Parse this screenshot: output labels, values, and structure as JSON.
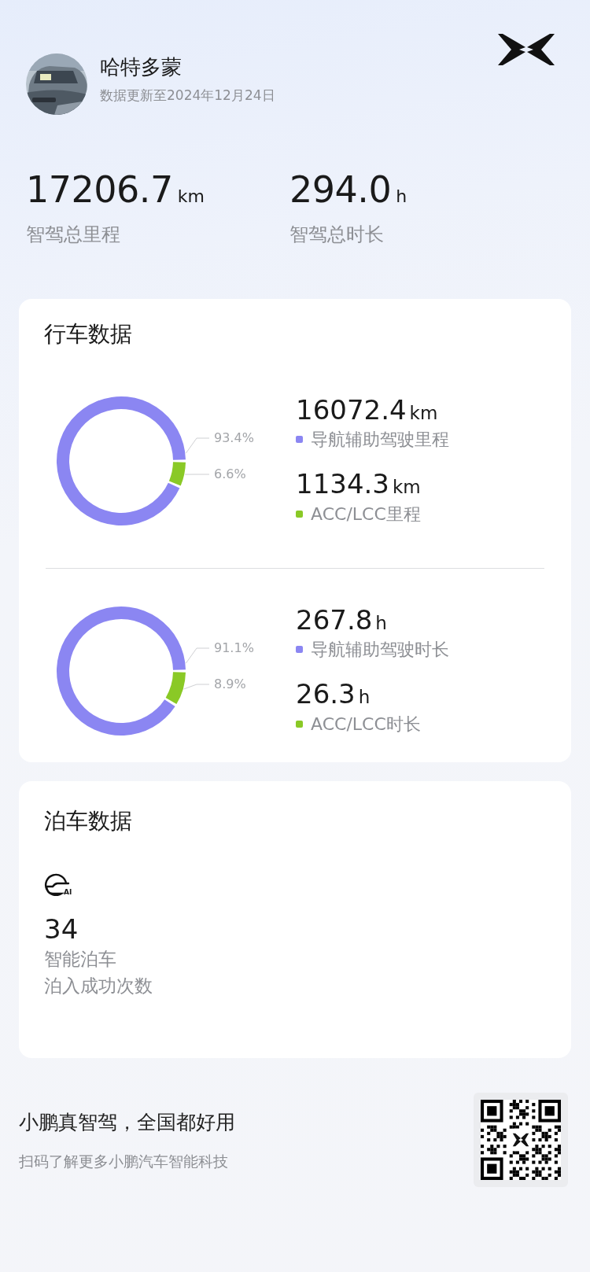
{
  "profile": {
    "kind": "picture",
    "name": "哈特多蒙",
    "updated": "数据更新至2024年12月24日"
  },
  "totals": [
    {
      "value": "17206.7",
      "unit": "km",
      "label": "智驾总里程"
    },
    {
      "value": "294.0",
      "unit": "h",
      "label": "智驾总时长"
    }
  ],
  "driving_card": {
    "title": "行车数据",
    "groups": [
      {
        "chart_data": {
          "type": "donut",
          "values": [
            93.4,
            6.6
          ],
          "value_labels": [
            "93.4%",
            "6.6%"
          ]
        },
        "items": [
          {
            "value": "16072.4",
            "unit": "km",
            "label": "导航辅助驾驶里程",
            "color": "#8b86f2"
          },
          {
            "value": "1134.3",
            "unit": "km",
            "label": "ACC/LCC里程",
            "color": "#8ac926"
          }
        ]
      },
      {
        "chart_data": {
          "type": "donut",
          "values": [
            91.1,
            8.9
          ],
          "value_labels": [
            "91.1%",
            "8.9%"
          ]
        },
        "items": [
          {
            "value": "267.8",
            "unit": "h",
            "label": "导航辅助驾驶时长",
            "color": "#8b86f2"
          },
          {
            "value": "26.3",
            "unit": "h",
            "label": "ACC/LCC时长",
            "color": "#8ac926"
          }
        ]
      }
    ]
  },
  "parking_card": {
    "title": "泊车数据",
    "icon_label": "AI",
    "count": "34",
    "label": "智能泊车",
    "sublabel": "泊入成功次数"
  },
  "footer": {
    "slogan": "小鹏真智驾，全国都好用",
    "hint": "扫码了解更多小鹏汽车智能科技"
  }
}
